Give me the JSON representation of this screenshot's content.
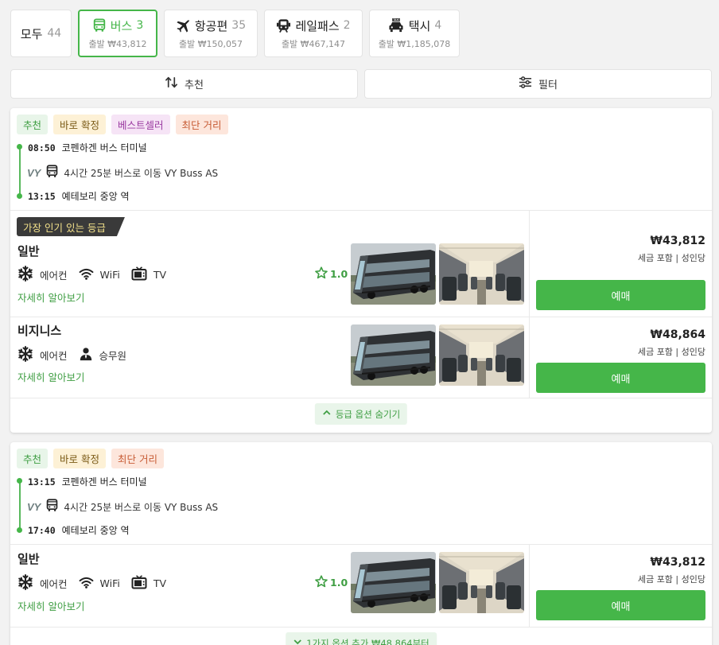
{
  "tabs": [
    {
      "label": "모두",
      "count": "44"
    },
    {
      "label": "버스",
      "count": "3",
      "sub": "출발 ₩43,812"
    },
    {
      "label": "항공편",
      "count": "35",
      "sub": "출발 ₩150,057"
    },
    {
      "label": "레일패스",
      "count": "2",
      "sub": "출발 ₩467,147"
    },
    {
      "label": "택시",
      "count": "4",
      "sub": "출발 ₩1,185,078"
    }
  ],
  "taxi_sign": "TAXI",
  "actions": {
    "sort_label": "추천",
    "filter_label": "필터"
  },
  "cards": [
    {
      "badges": [
        "추천",
        "바로 확정",
        "베스트셀러",
        "최단 거리"
      ],
      "depart_time": "08:50",
      "depart_place": "코펜하겐 버스 터미널",
      "operator_logo": "VY",
      "route": "4시간 25분 버스로 이동 VY Buss AS",
      "arrive_time": "13:15",
      "arrive_place": "예테보리 중앙 역",
      "classes": [
        {
          "popular": "가장 인기 있는 등급",
          "name": "일반",
          "amenities": [
            "에어컨",
            "WiFi",
            "TV"
          ],
          "rating": "1.0",
          "more": "자세히 알아보기",
          "price": "₩43,812",
          "price_note": "세금 포함 | 성인당",
          "book": "예매"
        },
        {
          "name": "비지니스",
          "amenities": [
            "에어컨",
            "승무원"
          ],
          "more": "자세히 알아보기",
          "price": "₩48,864",
          "price_note": "세금 포함 | 성인당",
          "book": "예매"
        }
      ],
      "toggle": "등급 옵션 숨기기"
    },
    {
      "badges": [
        "추천",
        "바로 확정",
        "최단 거리"
      ],
      "depart_time": "13:15",
      "depart_place": "코펜하겐 버스 터미널",
      "operator_logo": "VY",
      "route": "4시간 25분 버스로 이동 VY Buss AS",
      "arrive_time": "17:40",
      "arrive_place": "예테보리 중앙 역",
      "classes": [
        {
          "name": "일반",
          "amenities": [
            "에어컨",
            "WiFi",
            "TV"
          ],
          "rating": "1.0",
          "more": "자세히 알아보기",
          "price": "₩43,812",
          "price_note": "세금 포함 | 성인당",
          "book": "예매"
        }
      ],
      "toggle": "1가지 옵션 추가 ₩48,864부터"
    }
  ],
  "colors": {
    "accent": "#45b649",
    "popular_bg": "#3a3a3a",
    "popular_text": "#f2e08a"
  },
  "icons": [
    "bus-icon",
    "plane-icon",
    "train-icon",
    "taxi-icon",
    "sort-icon",
    "filter-icon",
    "snowflake-icon",
    "wifi-icon",
    "tv-icon",
    "attendant-icon",
    "star-icon",
    "chevron-up-icon",
    "chevron-down-icon"
  ]
}
